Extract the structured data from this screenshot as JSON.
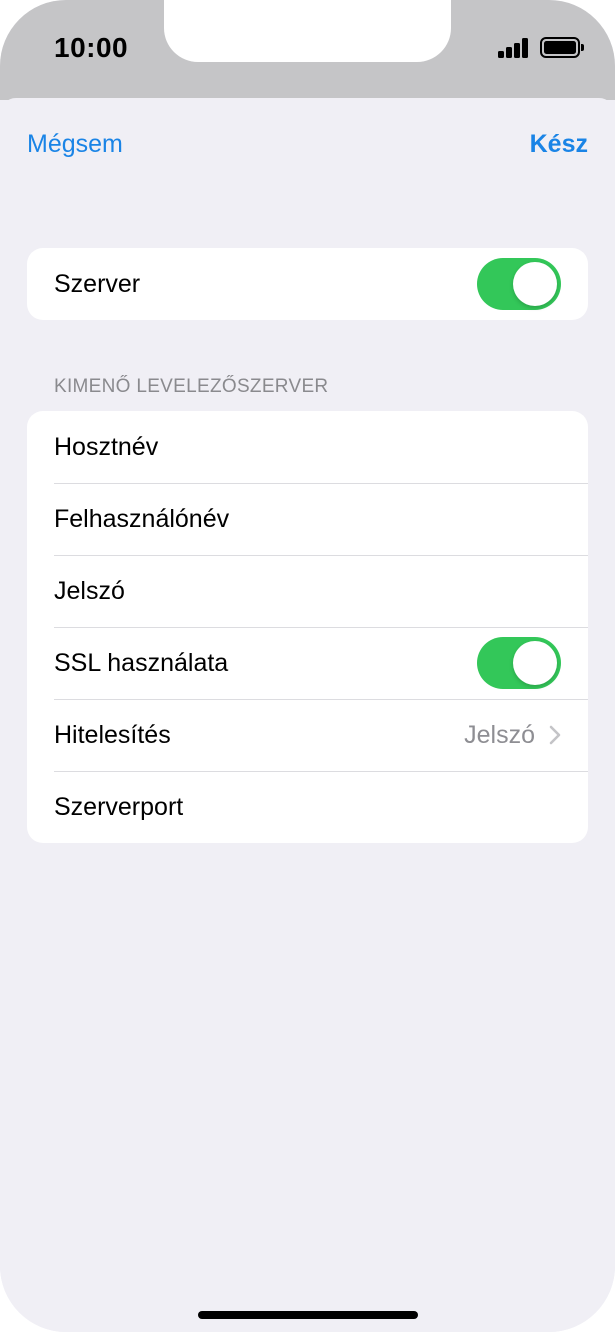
{
  "status_bar": {
    "time": "10:00"
  },
  "nav": {
    "cancel_label": "Mégsem",
    "done_label": "Kész"
  },
  "server_group": {
    "server_label": "Szerver",
    "server_toggle_on": true
  },
  "outgoing": {
    "header": "KIMENŐ LEVELEZŐSZERVER",
    "rows": {
      "hostname": "Hosztnév",
      "username": "Felhasználónév",
      "password": "Jelszó",
      "ssl": "SSL használata",
      "auth": "Hitelesítés",
      "auth_value": "Jelszó",
      "port": "Szerverport"
    },
    "ssl_toggle_on": true
  },
  "colors": {
    "accent": "#1a84e6",
    "toggle_on": "#33c759",
    "background": "#f0eff5"
  }
}
